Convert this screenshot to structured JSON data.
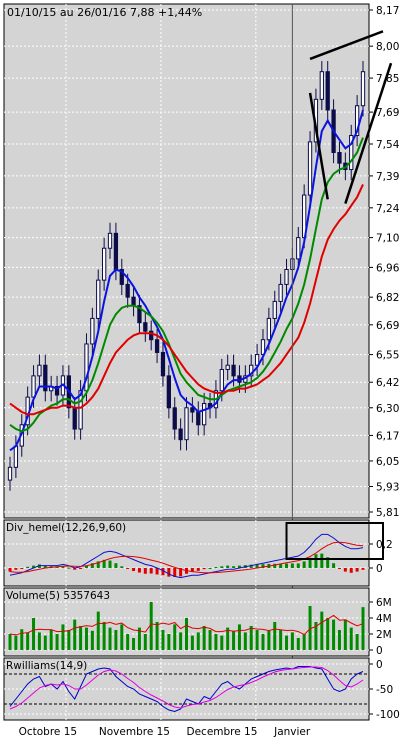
{
  "header": {
    "period": "01/10/15 au 26/01/16",
    "last": "7,88",
    "change": "+1,44%"
  },
  "colors": {
    "pane_bg": "#d4d4d4",
    "frame": "#000000",
    "grid": "#ffffff",
    "candle": "#0c0c4a",
    "ma_blue": "#0a14e0",
    "ma_green": "#008a00",
    "ma_red": "#e00000",
    "macd_line": "#1010d0",
    "signal_line": "#e00000",
    "hist_pos": "#008a00",
    "hist_neg": "#e00000",
    "vol_bar": "#008a00",
    "vol_avg": "#e00000",
    "wr_blue": "#0000c8",
    "wr_magenta": "#e000e0",
    "annotation": "#000000"
  },
  "chart_data": [
    {
      "type": "candlestick",
      "title": "01/10/15 au 26/01/16  7,88  +1,44%",
      "y_ticks": [
        "8,17",
        "8,00",
        "7,85",
        "7,69",
        "7,54",
        "7,39",
        "7,24",
        "7,10",
        "6,96",
        "6,82",
        "6,69",
        "6,55",
        "6,42",
        "6,30",
        "6,17",
        "6,05",
        "5,93",
        "5,81"
      ],
      "ylim": [
        5.81,
        8.17
      ],
      "close": [
        6.02,
        6.12,
        6.22,
        6.35,
        6.45,
        6.5,
        6.38,
        6.4,
        6.36,
        6.45,
        6.3,
        6.2,
        6.38,
        6.6,
        6.72,
        6.9,
        7.05,
        7.12,
        6.95,
        6.88,
        6.82,
        6.78,
        6.7,
        6.66,
        6.62,
        6.56,
        6.45,
        6.3,
        6.2,
        6.15,
        6.3,
        6.28,
        6.22,
        6.32,
        6.3,
        6.38,
        6.48,
        6.5,
        6.45,
        6.42,
        6.45,
        6.5,
        6.55,
        6.62,
        6.72,
        6.8,
        6.88,
        6.95,
        7.0,
        7.1,
        7.3,
        7.55,
        7.75,
        7.88,
        7.7,
        7.5,
        7.45,
        7.42,
        7.58,
        7.72,
        7.88
      ],
      "series": [
        {
          "name": "MA short",
          "values": [
            6.1,
            6.12,
            6.18,
            6.26,
            6.34,
            6.4,
            6.4,
            6.4,
            6.39,
            6.41,
            6.38,
            6.34,
            6.36,
            6.44,
            6.54,
            6.66,
            6.8,
            6.92,
            6.95,
            6.94,
            6.91,
            6.87,
            6.82,
            6.78,
            6.73,
            6.68,
            6.62,
            6.53,
            6.44,
            6.36,
            6.33,
            6.31,
            6.28,
            6.29,
            6.3,
            6.32,
            6.37,
            6.41,
            6.43,
            6.43,
            6.44,
            6.46,
            6.49,
            6.54,
            6.6,
            6.67,
            6.74,
            6.82,
            6.88,
            6.96,
            7.08,
            7.25,
            7.43,
            7.6,
            7.65,
            7.6,
            7.56,
            7.52,
            7.54,
            7.6,
            7.7
          ]
        },
        {
          "name": "MA medium",
          "values": [
            6.22,
            6.2,
            6.19,
            6.2,
            6.23,
            6.27,
            6.29,
            6.31,
            6.32,
            6.34,
            6.34,
            6.32,
            6.33,
            6.37,
            6.43,
            6.51,
            6.6,
            6.69,
            6.74,
            6.77,
            6.78,
            6.78,
            6.77,
            6.75,
            6.73,
            6.7,
            6.66,
            6.6,
            6.53,
            6.46,
            6.42,
            6.39,
            6.36,
            6.35,
            6.34,
            6.34,
            6.36,
            6.38,
            6.39,
            6.4,
            6.41,
            6.42,
            6.44,
            6.47,
            6.51,
            6.56,
            6.61,
            6.67,
            6.72,
            6.79,
            6.88,
            7.0,
            7.14,
            7.28,
            7.36,
            7.4,
            7.42,
            7.43,
            7.46,
            7.5,
            7.57
          ]
        },
        {
          "name": "MA long",
          "values": [
            6.32,
            6.3,
            6.28,
            6.27,
            6.27,
            6.28,
            6.29,
            6.3,
            6.3,
            6.31,
            6.31,
            6.3,
            6.3,
            6.32,
            6.35,
            6.39,
            6.45,
            6.51,
            6.56,
            6.59,
            6.62,
            6.64,
            6.65,
            6.65,
            6.65,
            6.64,
            6.62,
            6.59,
            6.55,
            6.51,
            6.47,
            6.44,
            6.41,
            6.39,
            6.38,
            6.37,
            6.37,
            6.38,
            6.38,
            6.39,
            6.39,
            6.4,
            6.41,
            6.43,
            6.45,
            6.48,
            6.51,
            6.55,
            6.59,
            6.63,
            6.7,
            6.79,
            6.9,
            7.01,
            7.09,
            7.14,
            7.18,
            7.21,
            7.25,
            7.29,
            7.35
          ]
        }
      ]
    },
    {
      "type": "macd",
      "label": "Div_hemel(12,26,9,60)",
      "y_ticks": [
        "0,2",
        "0"
      ],
      "ylim": [
        -0.1,
        0.35
      ],
      "series": [
        {
          "name": "line",
          "values": [
            -0.06,
            -0.05,
            -0.04,
            -0.02,
            0.0,
            0.02,
            0.02,
            0.02,
            0.02,
            0.03,
            0.02,
            0.0,
            0.01,
            0.04,
            0.07,
            0.1,
            0.13,
            0.14,
            0.13,
            0.11,
            0.09,
            0.07,
            0.05,
            0.03,
            0.02,
            0.0,
            -0.02,
            -0.05,
            -0.07,
            -0.08,
            -0.07,
            -0.06,
            -0.06,
            -0.05,
            -0.04,
            -0.03,
            -0.02,
            -0.01,
            -0.01,
            0.0,
            0.01,
            0.02,
            0.03,
            0.04,
            0.05,
            0.06,
            0.07,
            0.08,
            0.09,
            0.1,
            0.13,
            0.18,
            0.24,
            0.28,
            0.28,
            0.25,
            0.21,
            0.18,
            0.16,
            0.16,
            0.17
          ]
        },
        {
          "name": "signal",
          "values": [
            -0.03,
            -0.035,
            -0.035,
            -0.03,
            -0.02,
            -0.01,
            0.0,
            0.005,
            0.01,
            0.015,
            0.017,
            0.014,
            0.013,
            0.018,
            0.03,
            0.045,
            0.062,
            0.078,
            0.09,
            0.096,
            0.098,
            0.095,
            0.088,
            0.078,
            0.066,
            0.054,
            0.04,
            0.022,
            0.005,
            -0.01,
            -0.022,
            -0.03,
            -0.036,
            -0.04,
            -0.04,
            -0.038,
            -0.034,
            -0.03,
            -0.025,
            -0.02,
            -0.014,
            -0.008,
            0.0,
            0.008,
            0.016,
            0.025,
            0.034,
            0.043,
            0.052,
            0.062,
            0.075,
            0.095,
            0.125,
            0.16,
            0.19,
            0.21,
            0.215,
            0.21,
            0.2,
            0.19,
            0.185
          ]
        }
      ]
    },
    {
      "type": "bar",
      "label": "Volume(5) 5357643",
      "y_ticks": [
        "6M",
        "4M",
        "2M",
        "0"
      ],
      "ylim": [
        0,
        7000000
      ],
      "values": [
        2000000,
        1800000,
        2600000,
        2200000,
        4000000,
        2200000,
        1800000,
        2500000,
        2000000,
        3200000,
        2500000,
        3800000,
        3000000,
        2800000,
        2400000,
        4800000,
        3500000,
        2800000,
        2500000,
        3200000,
        2000000,
        1500000,
        2800000,
        2000000,
        6000000,
        3500000,
        2500000,
        2000000,
        3200000,
        2200000,
        4000000,
        1800000,
        2200000,
        3000000,
        2500000,
        2000000,
        1800000,
        2800000,
        2400000,
        3200000,
        2200000,
        3000000,
        2500000,
        2000000,
        2400000,
        3500000,
        2500000,
        1800000,
        2200000,
        1500000,
        2000000,
        5500000,
        3500000,
        4800000,
        4000000,
        3800000,
        2500000,
        3800000,
        2800000,
        2000000,
        5357643
      ],
      "series": [
        {
          "name": "average",
          "values": [
            2000000,
            1900000,
            2100000,
            2150000,
            2500000,
            2600000,
            2550000,
            2550000,
            2300000,
            2350000,
            2400000,
            2750000,
            2900000,
            3050000,
            2950000,
            3350000,
            3300000,
            3450000,
            3200000,
            3360000,
            2800000,
            2500000,
            2400000,
            2240000,
            3260000,
            3160000,
            3360000,
            3200000,
            3440000,
            2680000,
            3080000,
            2740000,
            2680000,
            2840000,
            2700000,
            2300000,
            2300000,
            2460000,
            2340000,
            2440000,
            2480000,
            2720000,
            2620000,
            2580000,
            2420000,
            2620000,
            2520000,
            2440000,
            2480000,
            2300000,
            1920000,
            2660000,
            2940000,
            3460000,
            3860000,
            4320000,
            3720000,
            3780000,
            3380000,
            3020000,
            3290000
          ]
        }
      ]
    },
    {
      "type": "line",
      "label": "Rwilliams(14,9)",
      "y_ticks": [
        "0",
        "-50",
        "-100"
      ],
      "ylim": [
        -100,
        0
      ],
      "reference_lines": [
        -20,
        -80
      ],
      "series": [
        {
          "name": "%R",
          "values": [
            -85,
            -70,
            -55,
            -40,
            -30,
            -25,
            -45,
            -40,
            -50,
            -35,
            -55,
            -70,
            -45,
            -20,
            -15,
            -10,
            -8,
            -10,
            -25,
            -35,
            -45,
            -50,
            -60,
            -65,
            -70,
            -75,
            -85,
            -92,
            -95,
            -90,
            -70,
            -75,
            -80,
            -65,
            -70,
            -55,
            -40,
            -35,
            -45,
            -50,
            -40,
            -30,
            -25,
            -20,
            -15,
            -12,
            -10,
            -8,
            -10,
            -5,
            -5,
            -5,
            -8,
            -10,
            -30,
            -50,
            -55,
            -50,
            -30,
            -20,
            -15
          ]
        },
        {
          "name": "signal",
          "values": [
            -90,
            -85,
            -78,
            -68,
            -58,
            -48,
            -43,
            -40,
            -42,
            -40,
            -43,
            -50,
            -50,
            -42,
            -32,
            -22,
            -15,
            -12,
            -14,
            -20,
            -29,
            -37,
            -47,
            -55,
            -62,
            -68,
            -74,
            -81,
            -86,
            -88,
            -84,
            -81,
            -80,
            -76,
            -73,
            -67,
            -59,
            -51,
            -46,
            -43,
            -41,
            -37,
            -32,
            -26,
            -21,
            -16,
            -13,
            -11,
            -10,
            -8,
            -7,
            -6,
            -6,
            -7,
            -13,
            -22,
            -33,
            -43,
            -46,
            -40,
            -32
          ]
        }
      ]
    }
  ],
  "x_axis": {
    "month_labels": [
      "Octobre 15",
      "Novembre 15",
      "Decembre 15",
      "Janvier"
    ]
  }
}
